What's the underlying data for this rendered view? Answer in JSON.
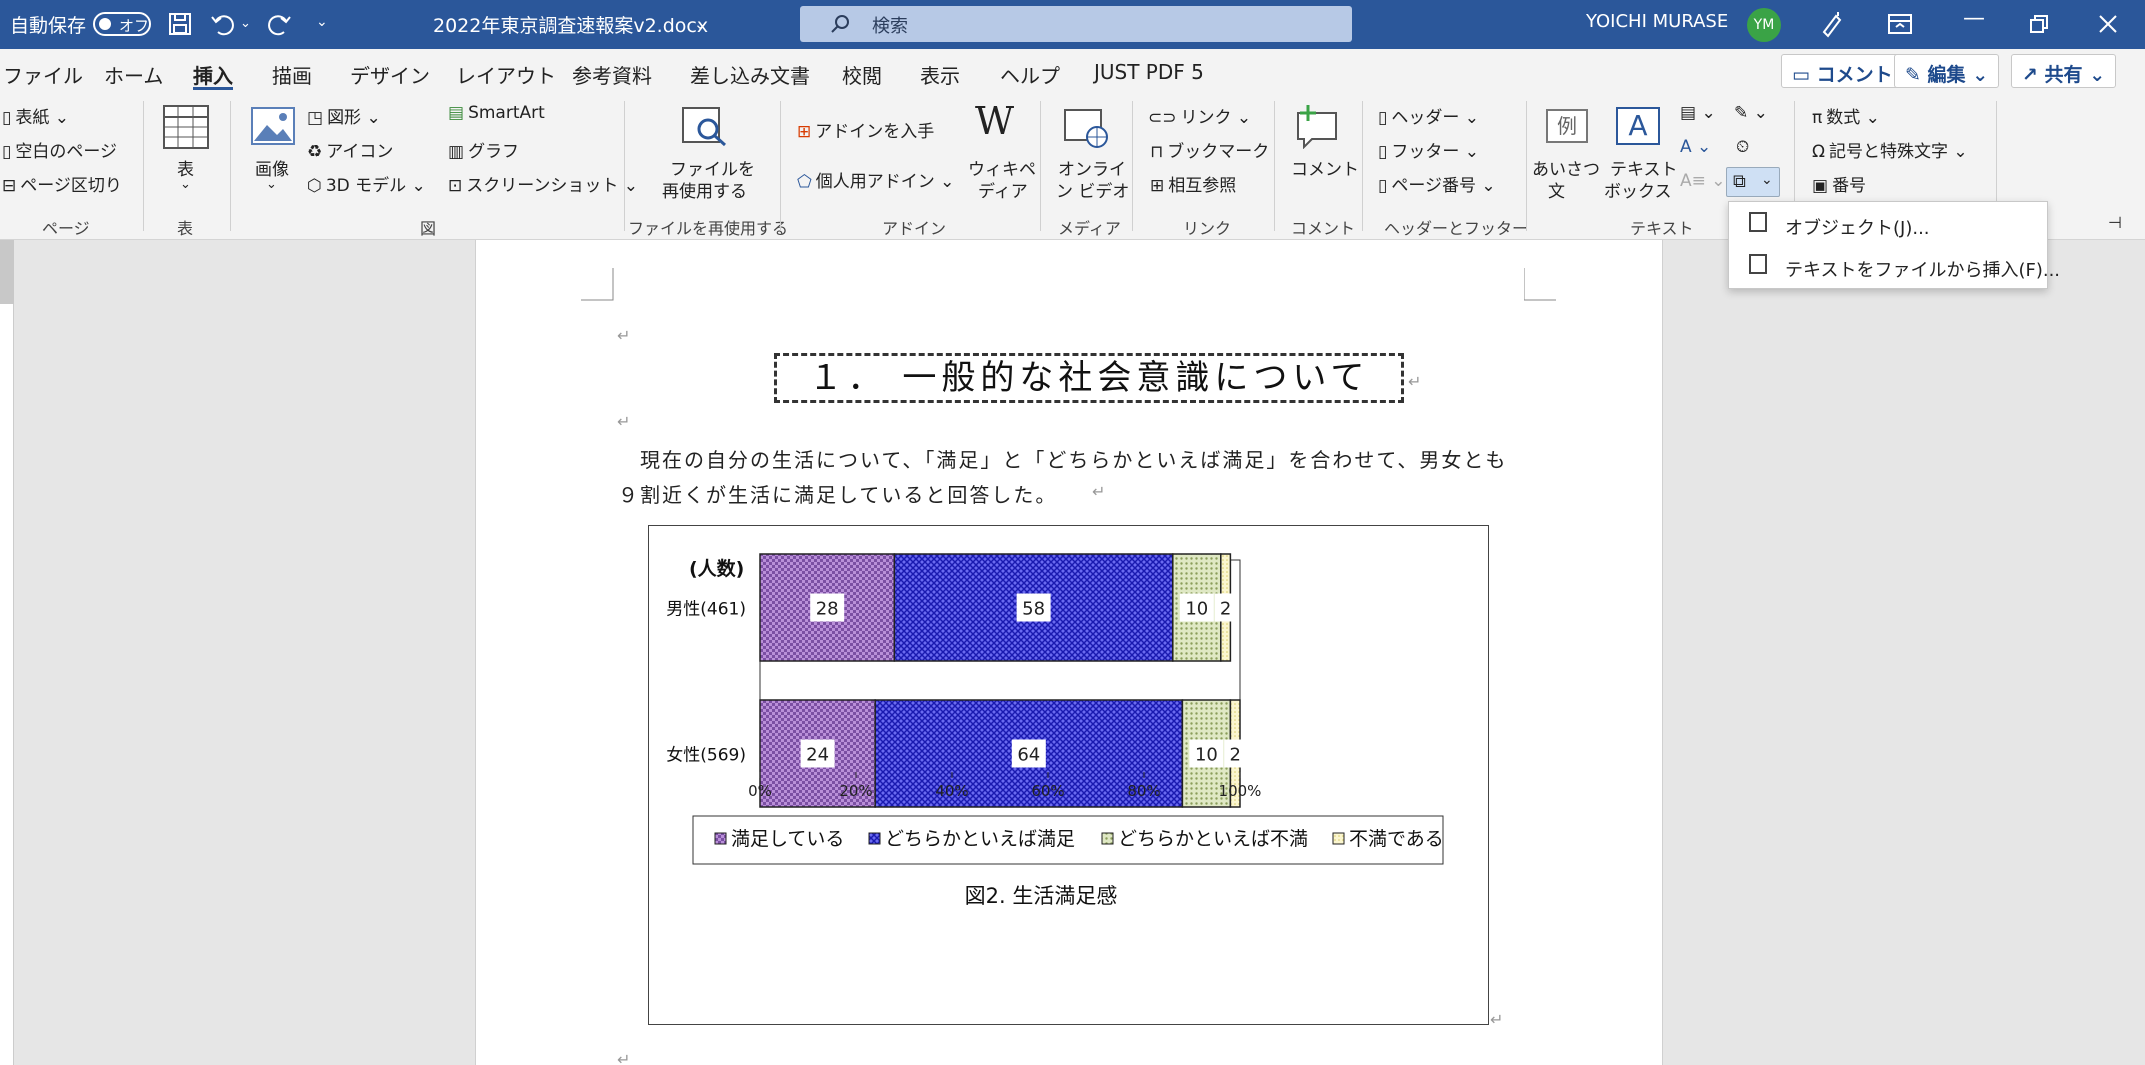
{
  "titlebar": {
    "autosave_label": "自動保存",
    "autosave_state": "オフ",
    "doc_title": "2022年東京調査速報案v2.docx",
    "search_placeholder": "検索",
    "user_name": "YOICHI MURASE",
    "user_initials": "YM"
  },
  "menu": {
    "tabs": [
      "ファイル",
      "ホーム",
      "挿入",
      "描画",
      "デザイン",
      "レイアウト",
      "参考資料",
      "差し込み文書",
      "校閲",
      "表示",
      "ヘルプ",
      "JUST PDF 5"
    ],
    "active_tab": "挿入",
    "comment_btn": "コメント",
    "edit_btn": "編集",
    "share_btn": "共有"
  },
  "ribbon": {
    "pages": {
      "cover": "表紙",
      "blank": "空白のページ",
      "break": "ページ区切り",
      "label": "ページ"
    },
    "table": {
      "table": "表",
      "label": "表"
    },
    "illust": {
      "picture": "画像",
      "shapes": "図形",
      "icons": "アイコン",
      "model3d": "3D モデル",
      "smartart": "SmartArt",
      "chart": "グラフ",
      "screenshot": "スクリーンショット",
      "label": "図"
    },
    "reuse": {
      "line1": "ファイルを",
      "line2": "再使用する",
      "label": "ファイルを再使用する"
    },
    "addins": {
      "get": "アドインを入手",
      "my": "個人用アドイン",
      "wiki1": "ウィキペ",
      "wiki2": "ディア",
      "label": "アドイン"
    },
    "media": {
      "line1": "オンライ",
      "line2": "ン ビデオ",
      "label": "メディア"
    },
    "links": {
      "link": "リンク",
      "bookmark": "ブックマーク",
      "xref": "相互参照",
      "label": "リンク"
    },
    "comments": {
      "comment": "コメント",
      "label": "コメント"
    },
    "hf": {
      "header": "ヘッダー",
      "footer": "フッター",
      "pagenum": "ページ番号",
      "label": "ヘッダーとフッター"
    },
    "text": {
      "greet1": "あいさつ",
      "greet2": "文",
      "tb1": "テキスト",
      "tb2": "ボックス",
      "label": "テキスト"
    },
    "symbols": {
      "equation": "数式",
      "symbol": "記号と特殊文字",
      "number": "番号"
    }
  },
  "dropdown": {
    "items": [
      "オブジェクト(J)...",
      "テキストをファイルから挿入(F)..."
    ]
  },
  "document": {
    "heading": "１． 一般的な社会意識について",
    "body": "現在の自分の生活について、「満足」と「どちらかといえば満足」を合わせて、男女とも９割近くが生活に満足していると回答した。",
    "para_mark": "↵"
  },
  "chart_data": {
    "type": "bar",
    "orientation": "horizontal-stacked-100",
    "title": "図2. 生活満足感",
    "unit_label": "(人数)",
    "categories": [
      "男性(461)",
      "女性(569)"
    ],
    "series": [
      {
        "name": "満足している",
        "values": [
          28,
          24
        ],
        "color": "#9b6fc0"
      },
      {
        "name": "どちらかといえば満足",
        "values": [
          58,
          64
        ],
        "color": "#2d2dd6"
      },
      {
        "name": "どちらかといえば不満",
        "values": [
          10,
          10
        ],
        "color": "#b5c48a"
      },
      {
        "name": "不満である",
        "values": [
          2,
          2
        ],
        "color": "#f4eda8"
      }
    ],
    "xticks": [
      "0%",
      "20%",
      "40%",
      "60%",
      "80%",
      "100%"
    ],
    "xlim": [
      0,
      100
    ],
    "legend": "bottom"
  }
}
